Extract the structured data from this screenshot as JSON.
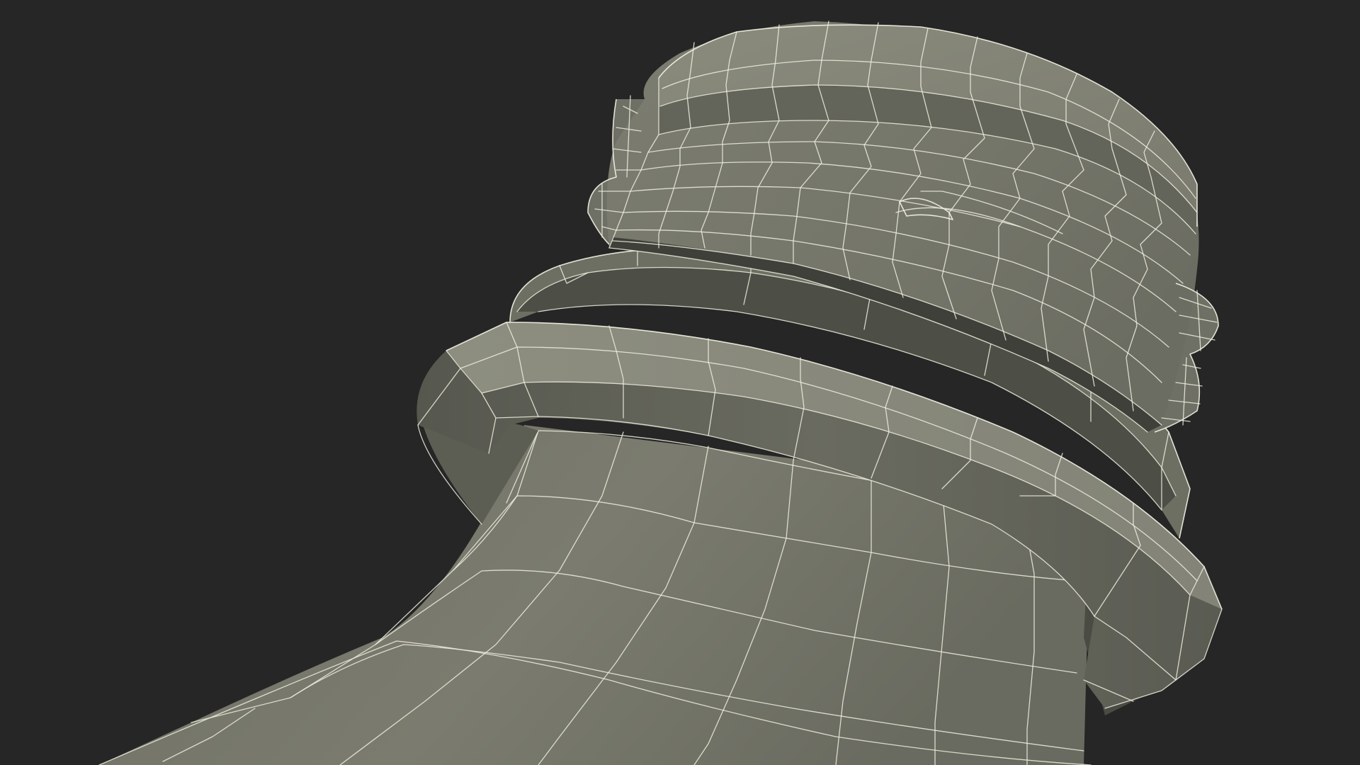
{
  "scene": {
    "subject": "wireframe-mesh-model",
    "colors": {
      "background": "#262626",
      "surface_light": "#8a8b7c",
      "surface_mid": "#75766a",
      "surface_dark": "#4b4c44",
      "shadow": "#3a3b35",
      "wireframe": "#eeeedf"
    }
  }
}
